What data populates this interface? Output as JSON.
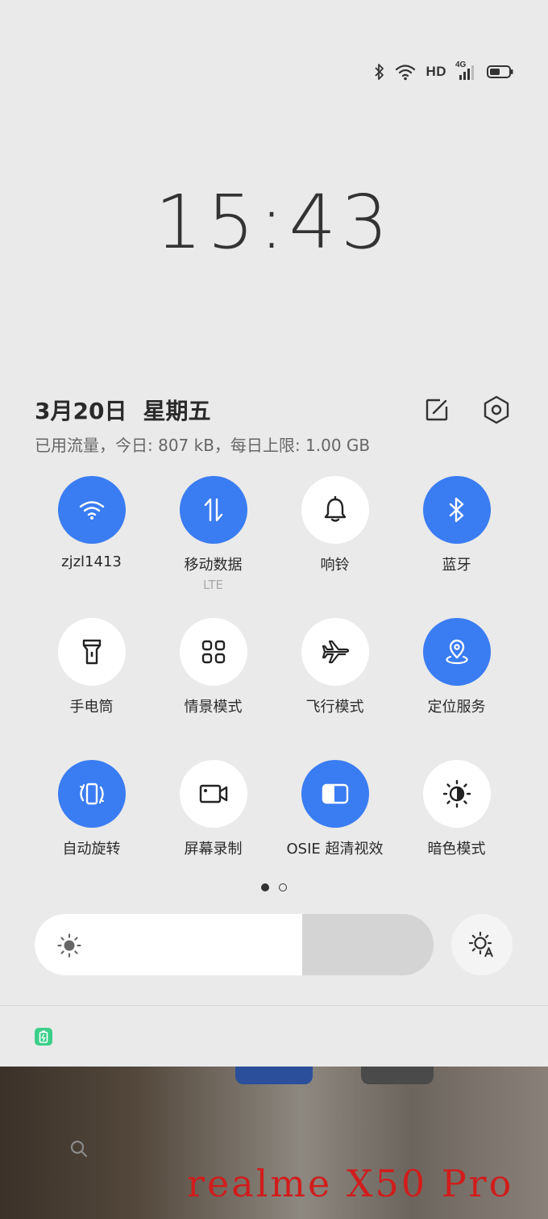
{
  "status_bar": {
    "hd_label": "HD",
    "network_type": "4G",
    "icons": [
      "bluetooth-icon",
      "wifi-icon",
      "hd-voice-icon",
      "signal-4g-icon",
      "battery-icon"
    ]
  },
  "lock": {
    "time": "15:43"
  },
  "header": {
    "date": "3月20日",
    "weekday": "星期五",
    "data_usage": "已用流量，今日: 807 kB，每日上限: 1.00 GB",
    "actions": [
      "edit-icon",
      "settings-icon"
    ]
  },
  "tiles": [
    {
      "label": "zjzl1413",
      "sub": "",
      "icon": "wifi-icon",
      "active": true
    },
    {
      "label": "移动数据",
      "sub": "LTE",
      "icon": "mobile-data-icon",
      "active": true
    },
    {
      "label": "响铃",
      "sub": "",
      "icon": "bell-icon",
      "active": false
    },
    {
      "label": "蓝牙",
      "sub": "",
      "icon": "bluetooth-icon",
      "active": true
    },
    {
      "label": "手电筒",
      "sub": "",
      "icon": "flashlight-icon",
      "active": false
    },
    {
      "label": "情景模式",
      "sub": "",
      "icon": "scene-mode-icon",
      "active": false
    },
    {
      "label": "飞行模式",
      "sub": "",
      "icon": "airplane-icon",
      "active": false
    },
    {
      "label": "定位服务",
      "sub": "",
      "icon": "location-icon",
      "active": true
    },
    {
      "label": "自动旋转",
      "sub": "",
      "icon": "auto-rotate-icon",
      "active": true
    },
    {
      "label": "屏幕录制",
      "sub": "",
      "icon": "screen-record-icon",
      "active": false
    },
    {
      "label": "OSIE 超清视效",
      "sub": "",
      "icon": "osie-icon",
      "active": true
    },
    {
      "label": "暗色模式",
      "sub": "",
      "icon": "dark-mode-icon",
      "active": false
    }
  ],
  "pager": {
    "pages": 2,
    "current": 1
  },
  "brightness": {
    "level_percent": 67,
    "icon": "sun-icon",
    "auto_icon": "auto-brightness-icon"
  },
  "notification": {
    "icon": "battery-saver-icon"
  },
  "watermark": {
    "text": "realme X50 Pro"
  },
  "colors": {
    "accent": "#3a7cf2",
    "panel": "#eaeaea",
    "tile_off": "#ffffff",
    "watermark": "#d11c1c"
  }
}
